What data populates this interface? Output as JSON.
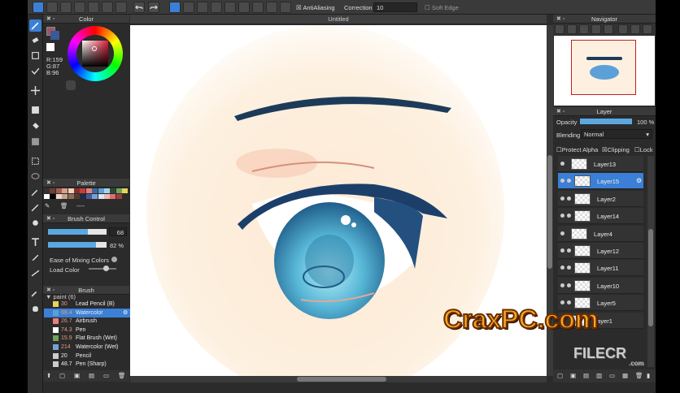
{
  "toolbar": {
    "antialiasing_label": "AntiAliasing",
    "correction_label": "Correction",
    "correction_value": "10",
    "soft_edge_label": "Soft Edge"
  },
  "document": {
    "title": "Untitled"
  },
  "color_panel": {
    "title": "Color",
    "r": "R:159",
    "g": "G:87",
    "b": "B:96"
  },
  "palette_panel": {
    "title": "Palette",
    "placeholder": "----",
    "swatches": [
      "#3b2f2a",
      "#6b3f36",
      "#a85e4b",
      "#d9a08a",
      "#f2d1c0",
      "#8a2c2c",
      "#c43d3d",
      "#e87f7f",
      "#3c6b9a",
      "#5da0d8",
      "#a7d0f0",
      "#2e4a2e",
      "#6fa35a",
      "#e8d35a",
      "#ffffff",
      "#000000",
      "#ead7c7",
      "#c7a38a",
      "#8f6b57",
      "#4d3b33",
      "#1f2a44",
      "#3d5a99",
      "#7a9fd6",
      "#d9e6f5",
      "#f0b3b3",
      "#d6706f",
      "#9e3d3c"
    ]
  },
  "brush_control": {
    "title": "Brush Control",
    "size_value": "68",
    "size_fraction": 0.68,
    "opacity_value": "82 %",
    "opacity_fraction": 0.82,
    "mixing_label": "Ease of Mixing Colors",
    "load_label": "Load Color"
  },
  "brush_panel": {
    "title": "Brush",
    "group": "paint (6)",
    "items": [
      {
        "num": "30",
        "name": "Lead Pencil (B)",
        "color": "#e8d35a",
        "selected": false
      },
      {
        "num": "69.4",
        "name": "Watercolor",
        "color": "#5da0d8",
        "selected": true
      },
      {
        "num": "26.7",
        "name": "Airbrush",
        "color": "#e87f7f",
        "selected": false
      },
      {
        "num": "74.3",
        "name": "Pen",
        "color": "#ffffff",
        "selected": false
      },
      {
        "num": "15.9",
        "name": "Flat Brush (Wet)",
        "color": "#6fa35a",
        "selected": false
      },
      {
        "num": "214",
        "name": "Watercolor (Wet)",
        "color": "#7a9fd6",
        "selected": false
      },
      {
        "num": "20",
        "name": "Pencil",
        "color": "#cccccc",
        "selected": false
      },
      {
        "num": "48.7",
        "name": "Pen (Sharp)",
        "color": "#cccccc",
        "selected": false
      }
    ]
  },
  "navigator": {
    "title": "Navigator"
  },
  "layer_panel": {
    "title": "Layer",
    "opacity_label": "Opacity",
    "opacity_value": "100 %",
    "blending_label": "Blending",
    "blending_value": "Normal",
    "protect_alpha_label": "Protect Alpha",
    "clipping_label": "Clipping",
    "lock_label": "Lock",
    "layers": [
      {
        "name": "Layer13",
        "indent": 0,
        "selected": false
      },
      {
        "name": "Layer15",
        "indent": 1,
        "selected": true
      },
      {
        "name": "Layer2",
        "indent": 1,
        "selected": false
      },
      {
        "name": "Layer14",
        "indent": 1,
        "selected": false
      },
      {
        "name": "Layer4",
        "indent": 0,
        "selected": false
      },
      {
        "name": "Layer12",
        "indent": 1,
        "selected": false
      },
      {
        "name": "Layer11",
        "indent": 1,
        "selected": false
      },
      {
        "name": "Layer10",
        "indent": 1,
        "selected": false
      },
      {
        "name": "Layer5",
        "indent": 1,
        "selected": false
      },
      {
        "name": "Layer1",
        "indent": 0,
        "selected": false
      }
    ]
  },
  "watermarks": {
    "craxpc": "CraxPC.com",
    "filecr": "FILECR",
    "filecr_sub": ".com"
  }
}
